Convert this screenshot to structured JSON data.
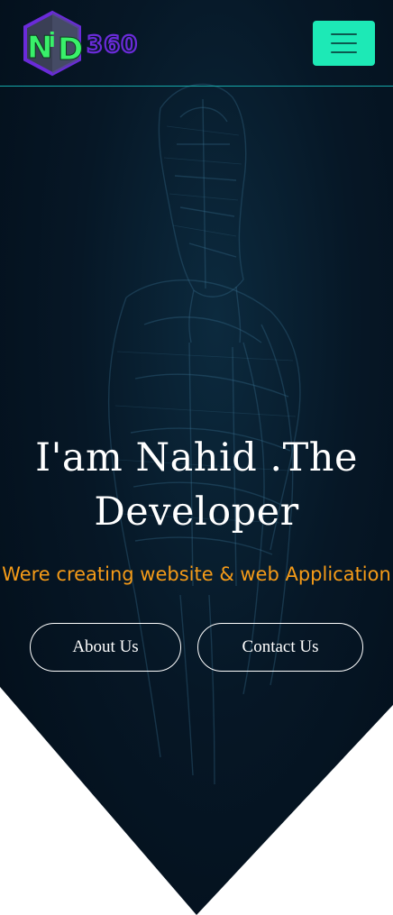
{
  "brand": {
    "logo_letters": "NiD",
    "logo_number": "360"
  },
  "nav": {
    "menu_icon": "hamburger-menu-icon"
  },
  "hero": {
    "headline_line1": "I'am Nahid .The",
    "headline_line2": "Developer",
    "tagline": "Were creating website & web Application",
    "about_button": "About Us",
    "contact_button": "Contact Us",
    "background_art": "robot-armor-wireframe"
  },
  "colors": {
    "accent": "#1de9b6",
    "tagline": "#f59b18",
    "hero_bg": "#061726",
    "logo_green": "#39f06a",
    "logo_purple": "#6a2bd9"
  }
}
